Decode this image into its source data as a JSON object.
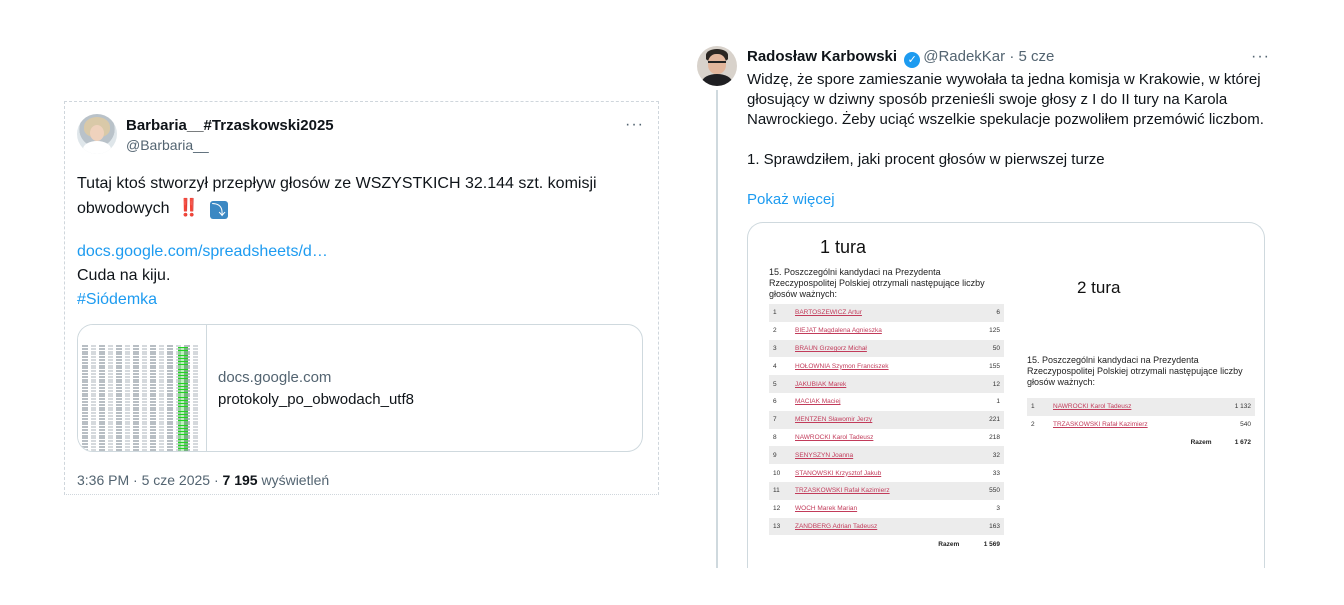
{
  "left_tweet": {
    "display_name": "Barbaria__#Trzaskowski2025",
    "handle": "@Barbaria__",
    "more": "···",
    "text": "Tutaj ktoś stworzył przepływ głosów ze WSZYSTKICH 32.144 szt. komisji obwodowych",
    "emoji_1": "‼️",
    "emoji_2": "⤵",
    "link": "docs.google.com/spreadsheets/d…",
    "line2": "Cuda na kiju.",
    "hashtag": "#Siódemka",
    "card": {
      "domain": "docs.google.com",
      "title": "protokoly_po_obwodach_utf8"
    },
    "meta": {
      "time_date": "3:36 PM · 5 cze 2025 · ",
      "views": "7 195",
      "views_label": " wyświetleń"
    }
  },
  "right_tweet": {
    "display_name": "Radosław Karbowski",
    "handle": "@RadekKar",
    "time": " · 5 cze",
    "more": "···",
    "paragraph_1": "Widzę, że spore zamieszanie wywołała ta jedna komisja w Krakowie, w której głosujący w dziwny sposób przenieśli swoje głosy z I do II tury na Karola Nawrockiego. Żeby uciąć wszelkie spekulacje pozwoliłem przemówić liczbom.",
    "paragraph_2": "1. Sprawdziłem, jaki procent głosów w pierwszej turze",
    "show_more": "Pokaż więcej",
    "image": {
      "round1_title": "1 tura",
      "round2_title": "2 tura",
      "section_title": "15. Poszczególni kandydaci na Prezydenta Rzeczypospolitej Polskiej otrzymali następujące liczby głosów ważnych:",
      "round1": [
        {
          "no": "1",
          "name": "BARTOSZEWICZ Artur",
          "votes": "6"
        },
        {
          "no": "2",
          "name": "BIEJAT Magdalena Agnieszka",
          "votes": "125"
        },
        {
          "no": "3",
          "name": "BRAUN Grzegorz Michał",
          "votes": "50"
        },
        {
          "no": "4",
          "name": "HOŁOWNIA Szymon Franciszek",
          "votes": "155"
        },
        {
          "no": "5",
          "name": "JAKUBIAK Marek",
          "votes": "12"
        },
        {
          "no": "6",
          "name": "MACIAK Maciej",
          "votes": "1"
        },
        {
          "no": "7",
          "name": "MENTZEN Sławomir Jerzy",
          "votes": "221"
        },
        {
          "no": "8",
          "name": "NAWROCKI Karol Tadeusz",
          "votes": "218"
        },
        {
          "no": "9",
          "name": "SENYSZYN Joanna",
          "votes": "32"
        },
        {
          "no": "10",
          "name": "STANOWSKI Krzysztof Jakub",
          "votes": "33"
        },
        {
          "no": "11",
          "name": "TRZASKOWSKI Rafał Kazimierz",
          "votes": "550"
        },
        {
          "no": "12",
          "name": "WOCH Marek Marian",
          "votes": "3"
        },
        {
          "no": "13",
          "name": "ZANDBERG Adrian Tadeusz",
          "votes": "163"
        }
      ],
      "round1_total_label": "Razem",
      "round1_total": "1 569",
      "round2": [
        {
          "no": "1",
          "name": "NAWROCKI Karol Tadeusz",
          "votes": "1 132"
        },
        {
          "no": "2",
          "name": "TRZASKOWSKI Rafał Kazimierz",
          "votes": "540"
        }
      ],
      "round2_total_label": "Razem",
      "round2_total": "1 672"
    }
  }
}
